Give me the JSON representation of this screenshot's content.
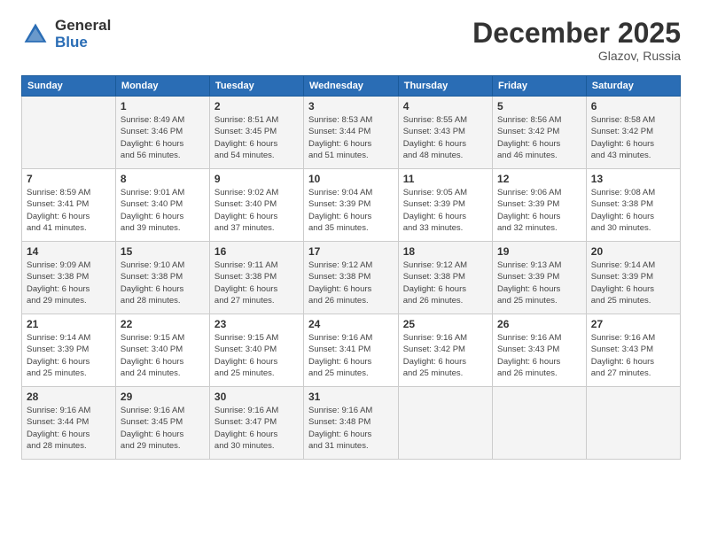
{
  "logo": {
    "general": "General",
    "blue": "Blue"
  },
  "title": "December 2025",
  "location": "Glazov, Russia",
  "days_header": [
    "Sunday",
    "Monday",
    "Tuesday",
    "Wednesday",
    "Thursday",
    "Friday",
    "Saturday"
  ],
  "weeks": [
    [
      {
        "num": "",
        "info": ""
      },
      {
        "num": "1",
        "info": "Sunrise: 8:49 AM\nSunset: 3:46 PM\nDaylight: 6 hours\nand 56 minutes."
      },
      {
        "num": "2",
        "info": "Sunrise: 8:51 AM\nSunset: 3:45 PM\nDaylight: 6 hours\nand 54 minutes."
      },
      {
        "num": "3",
        "info": "Sunrise: 8:53 AM\nSunset: 3:44 PM\nDaylight: 6 hours\nand 51 minutes."
      },
      {
        "num": "4",
        "info": "Sunrise: 8:55 AM\nSunset: 3:43 PM\nDaylight: 6 hours\nand 48 minutes."
      },
      {
        "num": "5",
        "info": "Sunrise: 8:56 AM\nSunset: 3:42 PM\nDaylight: 6 hours\nand 46 minutes."
      },
      {
        "num": "6",
        "info": "Sunrise: 8:58 AM\nSunset: 3:42 PM\nDaylight: 6 hours\nand 43 minutes."
      }
    ],
    [
      {
        "num": "7",
        "info": "Sunrise: 8:59 AM\nSunset: 3:41 PM\nDaylight: 6 hours\nand 41 minutes."
      },
      {
        "num": "8",
        "info": "Sunrise: 9:01 AM\nSunset: 3:40 PM\nDaylight: 6 hours\nand 39 minutes."
      },
      {
        "num": "9",
        "info": "Sunrise: 9:02 AM\nSunset: 3:40 PM\nDaylight: 6 hours\nand 37 minutes."
      },
      {
        "num": "10",
        "info": "Sunrise: 9:04 AM\nSunset: 3:39 PM\nDaylight: 6 hours\nand 35 minutes."
      },
      {
        "num": "11",
        "info": "Sunrise: 9:05 AM\nSunset: 3:39 PM\nDaylight: 6 hours\nand 33 minutes."
      },
      {
        "num": "12",
        "info": "Sunrise: 9:06 AM\nSunset: 3:39 PM\nDaylight: 6 hours\nand 32 minutes."
      },
      {
        "num": "13",
        "info": "Sunrise: 9:08 AM\nSunset: 3:38 PM\nDaylight: 6 hours\nand 30 minutes."
      }
    ],
    [
      {
        "num": "14",
        "info": "Sunrise: 9:09 AM\nSunset: 3:38 PM\nDaylight: 6 hours\nand 29 minutes."
      },
      {
        "num": "15",
        "info": "Sunrise: 9:10 AM\nSunset: 3:38 PM\nDaylight: 6 hours\nand 28 minutes."
      },
      {
        "num": "16",
        "info": "Sunrise: 9:11 AM\nSunset: 3:38 PM\nDaylight: 6 hours\nand 27 minutes."
      },
      {
        "num": "17",
        "info": "Sunrise: 9:12 AM\nSunset: 3:38 PM\nDaylight: 6 hours\nand 26 minutes."
      },
      {
        "num": "18",
        "info": "Sunrise: 9:12 AM\nSunset: 3:38 PM\nDaylight: 6 hours\nand 26 minutes."
      },
      {
        "num": "19",
        "info": "Sunrise: 9:13 AM\nSunset: 3:39 PM\nDaylight: 6 hours\nand 25 minutes."
      },
      {
        "num": "20",
        "info": "Sunrise: 9:14 AM\nSunset: 3:39 PM\nDaylight: 6 hours\nand 25 minutes."
      }
    ],
    [
      {
        "num": "21",
        "info": "Sunrise: 9:14 AM\nSunset: 3:39 PM\nDaylight: 6 hours\nand 25 minutes."
      },
      {
        "num": "22",
        "info": "Sunrise: 9:15 AM\nSunset: 3:40 PM\nDaylight: 6 hours\nand 24 minutes."
      },
      {
        "num": "23",
        "info": "Sunrise: 9:15 AM\nSunset: 3:40 PM\nDaylight: 6 hours\nand 25 minutes."
      },
      {
        "num": "24",
        "info": "Sunrise: 9:16 AM\nSunset: 3:41 PM\nDaylight: 6 hours\nand 25 minutes."
      },
      {
        "num": "25",
        "info": "Sunrise: 9:16 AM\nSunset: 3:42 PM\nDaylight: 6 hours\nand 25 minutes."
      },
      {
        "num": "26",
        "info": "Sunrise: 9:16 AM\nSunset: 3:43 PM\nDaylight: 6 hours\nand 26 minutes."
      },
      {
        "num": "27",
        "info": "Sunrise: 9:16 AM\nSunset: 3:43 PM\nDaylight: 6 hours\nand 27 minutes."
      }
    ],
    [
      {
        "num": "28",
        "info": "Sunrise: 9:16 AM\nSunset: 3:44 PM\nDaylight: 6 hours\nand 28 minutes."
      },
      {
        "num": "29",
        "info": "Sunrise: 9:16 AM\nSunset: 3:45 PM\nDaylight: 6 hours\nand 29 minutes."
      },
      {
        "num": "30",
        "info": "Sunrise: 9:16 AM\nSunset: 3:47 PM\nDaylight: 6 hours\nand 30 minutes."
      },
      {
        "num": "31",
        "info": "Sunrise: 9:16 AM\nSunset: 3:48 PM\nDaylight: 6 hours\nand 31 minutes."
      },
      {
        "num": "",
        "info": ""
      },
      {
        "num": "",
        "info": ""
      },
      {
        "num": "",
        "info": ""
      }
    ]
  ]
}
